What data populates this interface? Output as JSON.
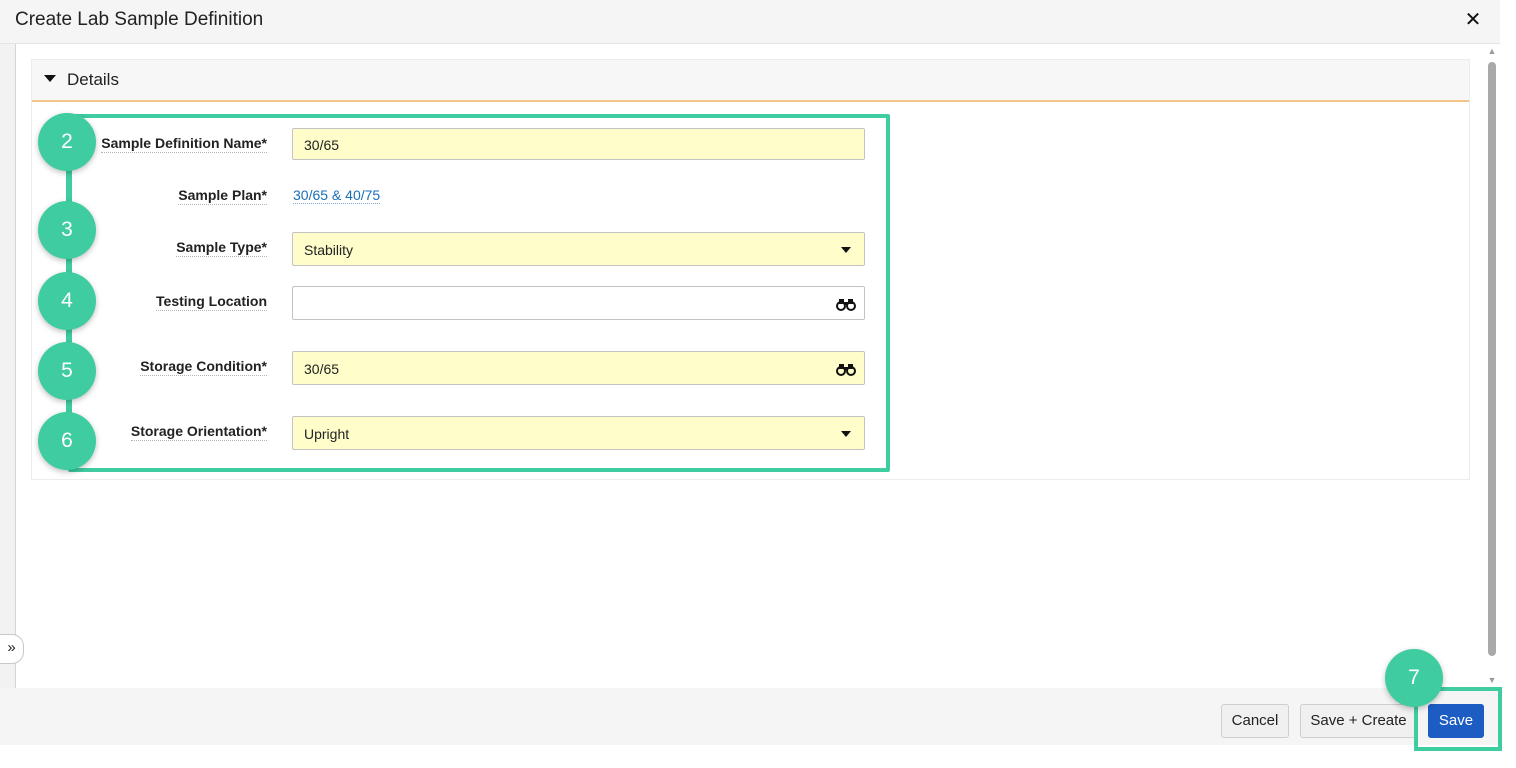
{
  "dialog": {
    "title": "Create Lab Sample Definition",
    "close_glyph": "✕"
  },
  "section": {
    "title": "Details"
  },
  "fields": {
    "sample_definition_name": {
      "label": "Sample Definition Name*",
      "value": "30/65"
    },
    "sample_plan": {
      "label": "Sample Plan*",
      "value": "30/65 & 40/75"
    },
    "sample_type": {
      "label": "Sample Type*",
      "value": "Stability"
    },
    "testing_location": {
      "label": "Testing Location",
      "value": ""
    },
    "storage_condition": {
      "label": "Storage Condition*",
      "value": "30/65"
    },
    "storage_orientation": {
      "label": "Storage Orientation*",
      "value": "Upright"
    }
  },
  "steps": [
    "2",
    "3",
    "4",
    "5",
    "6",
    "7"
  ],
  "footer": {
    "cancel_label": "Cancel",
    "save_create_label": "Save + Create",
    "save_label": "Save"
  },
  "rail": {
    "expand_glyph": "»"
  },
  "colors": {
    "accent_green": "#3fcca0",
    "primary_blue": "#1d5cc2",
    "required_field": "#fffdc9",
    "section_underline": "#f4c48a",
    "link": "#1a6fb7"
  }
}
